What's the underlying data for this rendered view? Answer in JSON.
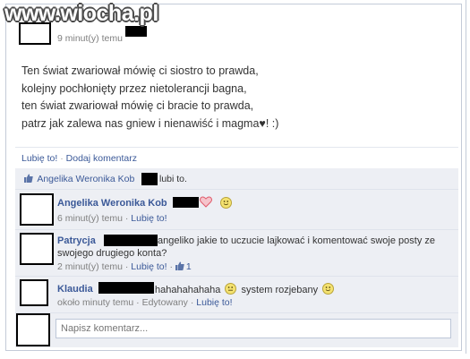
{
  "watermark": "www.wiocha.pl",
  "post": {
    "timestamp": "9 minut(y) temu",
    "body_lines": [
      "Ten świat zwariował mówię ci siostro to prawda,",
      "kolejny pochłonięty przez nietolerancji bagna,",
      "ten świat zwariował mówię ci bracie to prawda,",
      "patrz jak zalewa nas gniew i nienawiść i magma♥! :)"
    ],
    "like_label": "Lubię to!",
    "separator": "·",
    "comment_label": "Dodaj komentarz"
  },
  "likes": {
    "name": "Angelika Weronika Kob",
    "suffix": "lubi to."
  },
  "comments": [
    {
      "author": "Angelika Weronika Kob",
      "text_after": "",
      "time": "6 minut(y) temu",
      "like_label": "Lubię to!"
    },
    {
      "author": "Patrycja",
      "text": "angeliko jakie to uczucie lajkować i komentować swoje posty ze",
      "text_line2": "swojego drugiego konta?",
      "time": "2 minut(y) temu",
      "like_label": "Lubię to!",
      "like_count": "1"
    },
    {
      "author": "Klaudia",
      "text": "hahahahahaha",
      "text2": "system rozjebany",
      "time": "około minuty temu",
      "edited": "Edytowany",
      "like_label": "Lubię to!"
    }
  ],
  "composer": {
    "placeholder": "Napisz komentarz..."
  },
  "colors": {
    "link": "#3b5998",
    "comments_bg": "#edeff4",
    "heart": "#e05b6b",
    "smiley": "#f4e270"
  }
}
